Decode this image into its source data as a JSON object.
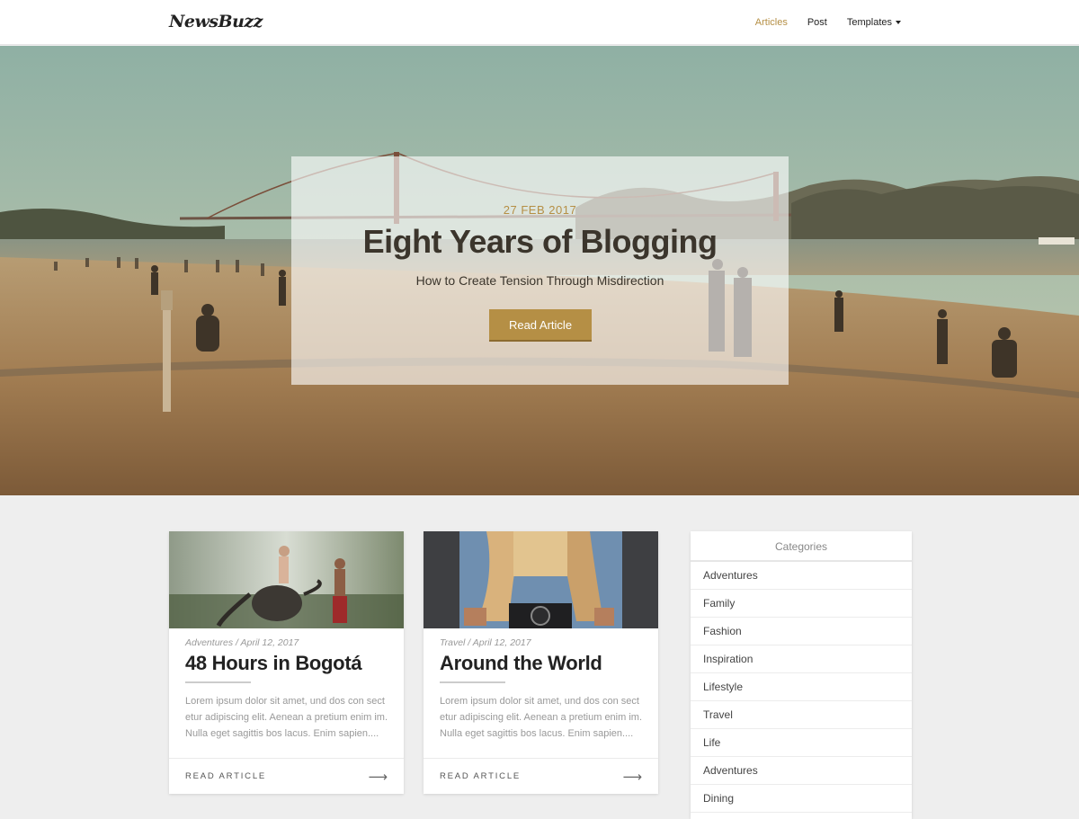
{
  "header": {
    "logo": "NewsBuzz",
    "nav": [
      {
        "label": "Articles"
      },
      {
        "label": "Post"
      },
      {
        "label": "Templates"
      }
    ]
  },
  "hero": {
    "date": "27 FEB 2017",
    "title": "Eight Years of Blogging",
    "subtitle": "How to Create Tension Through Misdirection",
    "button": "Read Article"
  },
  "cards": [
    {
      "meta": "Adventures / April 12, 2017",
      "title": "48 Hours in Bogotá",
      "excerpt": "Lorem ipsum dolor sit amet, und dos con sect etur adipiscing elit. Aenean a pretium enim im. Nulla eget sagittis bos lacus. Enim sapien....",
      "read": "READ ARTICLE"
    },
    {
      "meta": "Travel / April 12, 2017",
      "title": "Around the World",
      "excerpt": "Lorem ipsum dolor sit amet, und dos con sect etur adipiscing elit. Aenean a pretium enim im. Nulla eget sagittis bos lacus. Enim sapien....",
      "read": "READ ARTICLE"
    }
  ],
  "sidebar": {
    "title": "Categories",
    "items": [
      "Adventures",
      "Family",
      "Fashion",
      "Inspiration",
      "Lifestyle",
      "Travel",
      "Life",
      "Adventures",
      "Dining"
    ]
  },
  "icons": {
    "arrow": "arrow-right-icon",
    "caret": "caret-down-icon"
  },
  "colors": {
    "accent": "#b58f45"
  }
}
